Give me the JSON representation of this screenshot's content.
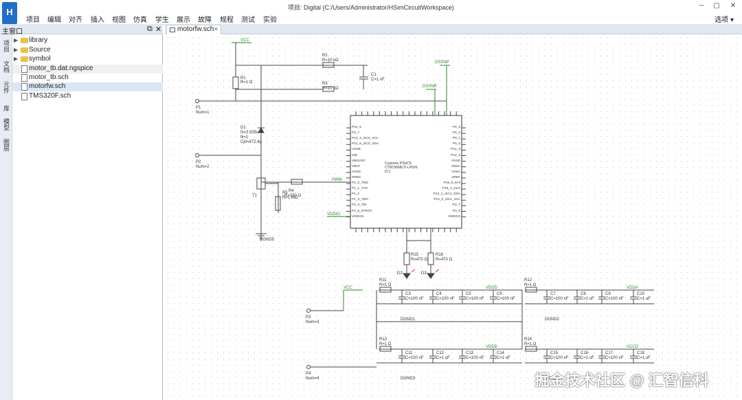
{
  "window": {
    "title": "项目: Digital (C:/Users/Administrator/HSimCircuitWorkspace)",
    "app_icon_text": "H",
    "minimize": "─",
    "maximize": "▢",
    "close": "✕"
  },
  "menu": {
    "items": [
      "项目",
      "编辑",
      "对齐",
      "插入",
      "视图",
      "仿真",
      "学生",
      "展示",
      "故障",
      "规程",
      "测试",
      "实验"
    ],
    "options": "选项 ▾"
  },
  "left_rail": {
    "tabs": [
      "项目",
      "文档",
      "元件",
      "库",
      "模型",
      "图层"
    ]
  },
  "panel": {
    "title": "主窗口",
    "float": "⧉",
    "close": "✕"
  },
  "tree": {
    "items": [
      {
        "label": "library",
        "kind": "folder",
        "expandable": true
      },
      {
        "label": "Source",
        "kind": "folder",
        "expandable": true
      },
      {
        "label": "symbol",
        "kind": "folder",
        "expandable": true
      },
      {
        "label": "motor_tb.dat.ngspice",
        "kind": "file",
        "expandable": false
      },
      {
        "label": "motor_tb.sch",
        "kind": "file",
        "expandable": false
      },
      {
        "label": "motorfw.sch",
        "kind": "file",
        "expandable": false
      },
      {
        "label": "TMS320F.sch",
        "kind": "file",
        "expandable": false
      }
    ]
  },
  "tab": {
    "label": "motorfw.sch",
    "close": "✕"
  },
  "schematic": {
    "net_vcc": "VCC",
    "net_dsense_p": "DSSNP",
    "net_dsense_n": "DSSNR",
    "net_pwm": "PWM",
    "net_vddio": "VDDIO",
    "net_vdda": "VDDA",
    "net_vddd": "VDDD",
    "net_vccd": "VCCD",
    "r1": "R1",
    "r1_val": "R=1 Ω",
    "r2": "R2",
    "r2_val": "R=10 kΩ",
    "r3": "R3",
    "r3_val": "R=10 kΩ",
    "r4": "R4",
    "r4_val": "R=330 Ω",
    "r5": "R5",
    "r5_val": "R=1 MΩ",
    "c1": "C1",
    "c1_val": "C=1 nF",
    "p1": "P1",
    "p1_num": "Num=1",
    "p2": "P2",
    "p2_num": "Num=2",
    "p3": "P3",
    "p3_num": "Num=3",
    "p4": "P4",
    "p4_num": "Num=4",
    "d1": "D1",
    "d1_is": "Is=2.835u",
    "d1_n": "N=1",
    "d1_cj": "Cj0=472.4p",
    "t1": "T1",
    "dgnd5": "DGND5",
    "ic_title": "Cypress PSoC5",
    "ic_part": "CY8C5668LTI-LP026",
    "ic_ref": "IC1",
    "ic_left_pins": [
      "P12_6",
      "P2_7",
      "P12_4_I2C0_SCL",
      "P12_5_I2C0_SDA",
      "VSSB",
      "IND",
      "VBOOST",
      "VBAT",
      "VSSD",
      "XRES",
      "P1_0_TMS",
      "P1_1_TCK",
      "P1_2",
      "P1_3_TDO",
      "P1_4_TDI",
      "P1_5_NTRST",
      "VDDIO1"
    ],
    "ic_right_pins": [
      "P0_3",
      "P0_2",
      "P0_1",
      "P0_0",
      "P12_3",
      "P12_2",
      "VSSD",
      "VDDA",
      "VSSA",
      "VREF",
      "P15_3_KHI",
      "P15_2_KLO",
      "P12_1_I2C1_SDA",
      "P12_0_I2C1_SCL",
      "P3_7",
      "P3_6",
      "VDDIO3"
    ],
    "r15": "R15",
    "r15_val": "R=470 Ω",
    "r16": "R16",
    "r16_val": "R=470 Ω",
    "d2": "D2",
    "d3": "D3",
    "r11": "R11",
    "r11_val": "R=1 Ω",
    "r12": "R12",
    "r12_val": "R=1 Ω",
    "r13": "R13",
    "r13_val": "R=1 Ω",
    "r14": "R14",
    "r14_val": "R=1 Ω",
    "c3": "C3",
    "c3_val": "C=100 nF",
    "c4": "C4",
    "c4_val": "C=100 nF",
    "c5": "C5",
    "c5_val": "C=100 nF",
    "c6": "C6",
    "c6_val": "C=100 nF",
    "c7": "C7",
    "c7_val": "C=100 nF",
    "c8": "C8",
    "c8_val": "C=1 uF",
    "c9": "C9",
    "c9_val": "C=100 nF",
    "c10": "C10",
    "c10_val": "C=1 uF",
    "c11": "C11",
    "c11_val": "C=100 nF",
    "c12": "C12",
    "c12_val": "C=1 uF",
    "c13": "C13",
    "c13_val": "C=100 nF",
    "c14": "C14",
    "c14_val": "C=1 uF",
    "c15": "C15",
    "c15_val": "C=100 nF",
    "c16": "C16",
    "c16_val": "C=1 uF",
    "c17": "C17",
    "c17_val": "C=100 nF",
    "c18": "C18",
    "c18_val": "C=1 uF",
    "dgnd1": "DGND1",
    "dgnd2": "DGND2",
    "dgnd3": "DGND3",
    "dgnd4": "DGND4"
  },
  "watermark": "掘金技术社区 @ 汇智信科"
}
